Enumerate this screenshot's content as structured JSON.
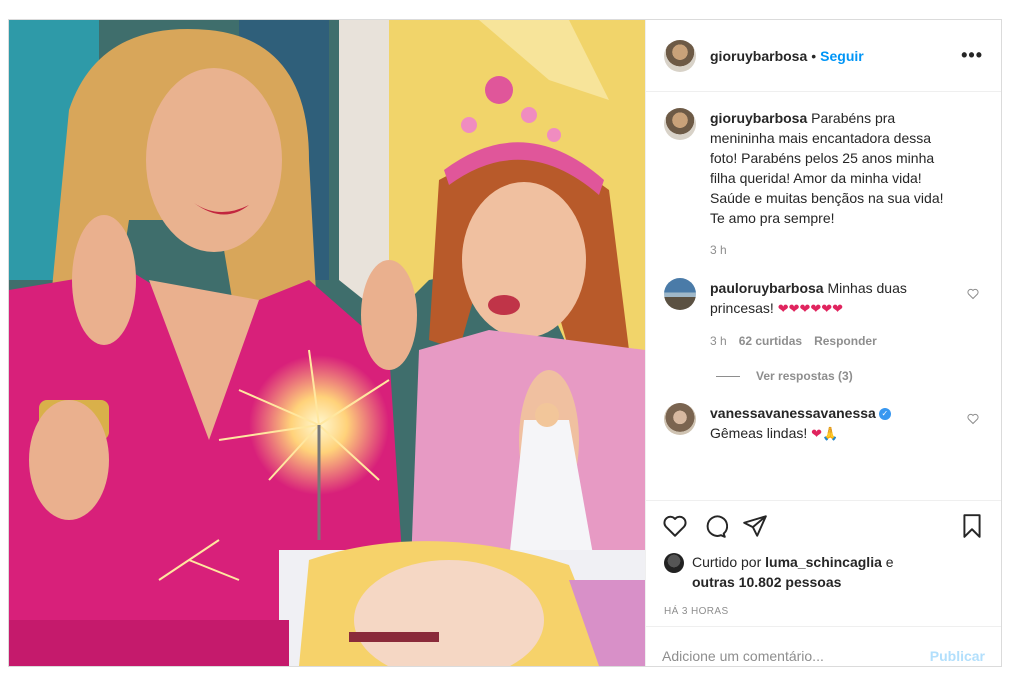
{
  "post": {
    "author": "gioruybarbosa",
    "follow_label": "Seguir",
    "more_label": "•••",
    "caption": "Parabéns pra menininha mais encantadora dessa foto! Parabéns pelos 25 anos minha filha querida! Amor da minha vida! Saúde e muitas bençãos na sua vida! Te amo pra sempre!",
    "caption_time": "3 h",
    "comments": [
      {
        "user": "pauloruybarbosa",
        "text": "Minhas duas princesas!",
        "emojis": "❤❤❤❤❤❤",
        "time": "3 h",
        "likes": "62 curtidas",
        "reply_label": "Responder"
      },
      {
        "user": "vanessavanessavanessa",
        "verified": "✓",
        "text": "Gêmeas lindas!",
        "emojis": "❤🙏"
      }
    ],
    "view_replies": "Ver respostas (3)",
    "liked_by_prefix": "Curtido por",
    "liked_by_user": "luma_schincaglia",
    "liked_by_and": "e",
    "liked_by_others": "outras 10.802 pessoas",
    "timestamp": "HÁ 3 HORAS",
    "comment_placeholder": "Adicione um comentário...",
    "publish_label": "Publicar"
  }
}
